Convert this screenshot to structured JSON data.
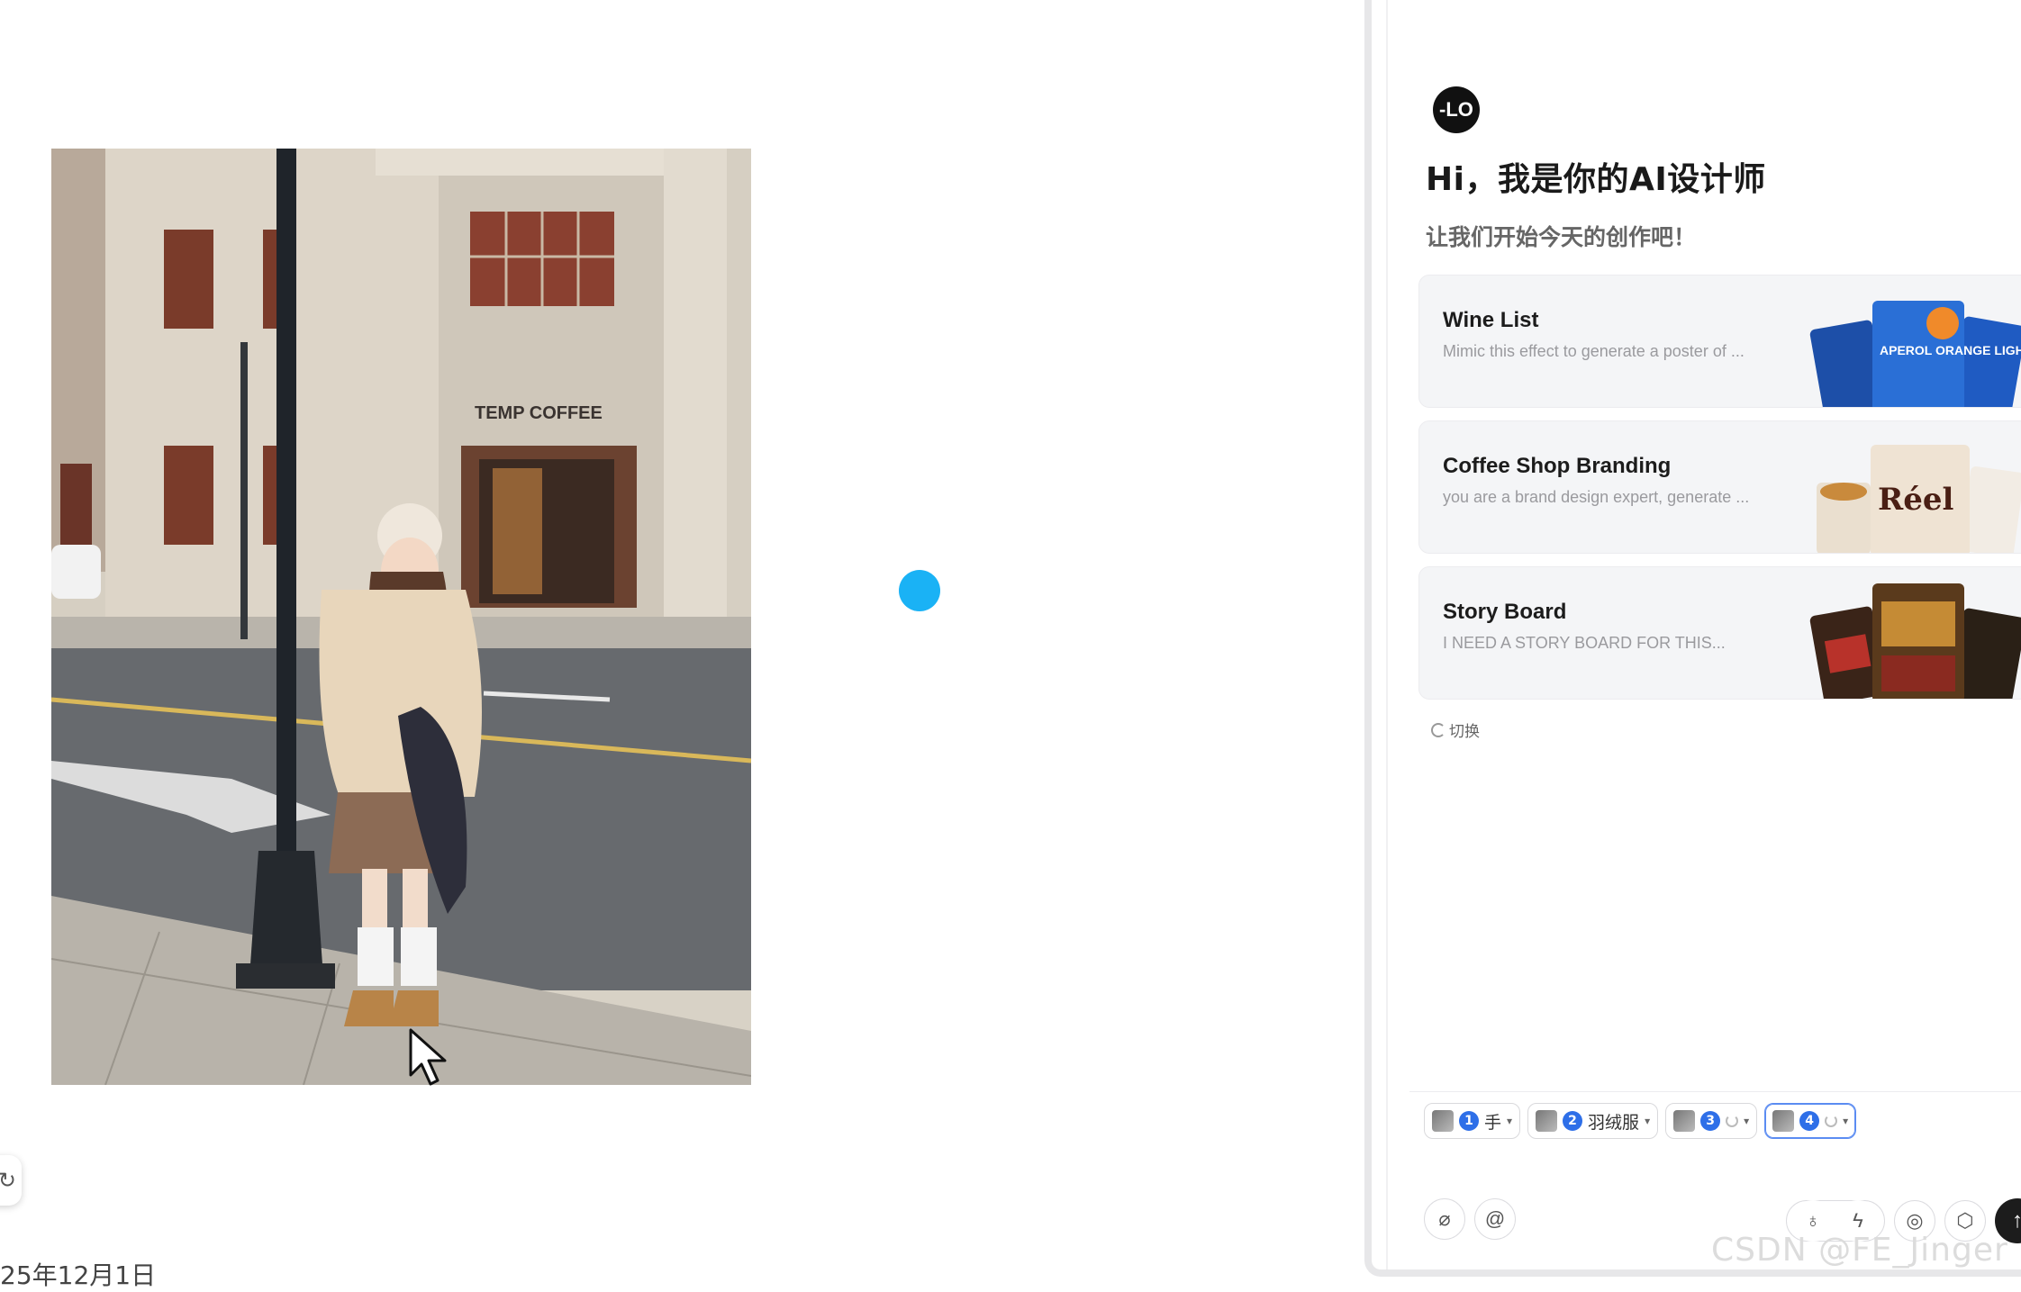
{
  "canvas": {
    "date_label": "25年12月1日"
  },
  "photo": {
    "sign_text": "TEMP COFFEE"
  },
  "panel": {
    "logo_text": "-LO",
    "greeting": "Hi，我是你的AI设计师",
    "subtitle": "让我们开始今天的创作吧！",
    "cards": [
      {
        "title": "Wine List",
        "desc": "Mimic this effect to generate a poster of ...",
        "art_text": "APEROL ORANGE LIGHT"
      },
      {
        "title": "Coffee Shop Branding",
        "desc": "you are a brand design expert, generate ...",
        "art_text": "Réel"
      },
      {
        "title": "Story Board",
        "desc": "I NEED A STORY BOARD FOR THIS...",
        "art_text": ""
      }
    ],
    "switch_label": "切换",
    "chips": [
      {
        "num": "1",
        "label": "手",
        "state": "done"
      },
      {
        "num": "2",
        "label": "羽绒服",
        "state": "done"
      },
      {
        "num": "3",
        "label": "",
        "state": "loading"
      },
      {
        "num": "4",
        "label": "",
        "state": "loading-active"
      }
    ],
    "tools": {
      "attach_icon": "paperclip-icon",
      "mention_icon": "at-icon",
      "idea_icon": "lightbulb-icon",
      "flash_icon": "lightning-icon",
      "web_icon": "globe-icon",
      "cube_icon": "cube-icon",
      "send_icon": "arrow-up-icon"
    }
  },
  "watermark": "CSDN @FE_Jinger",
  "colors": {
    "accent_blue": "#1ab2f5",
    "chip_blue": "#2e6fe8",
    "send_button": "#1c1c1c"
  }
}
